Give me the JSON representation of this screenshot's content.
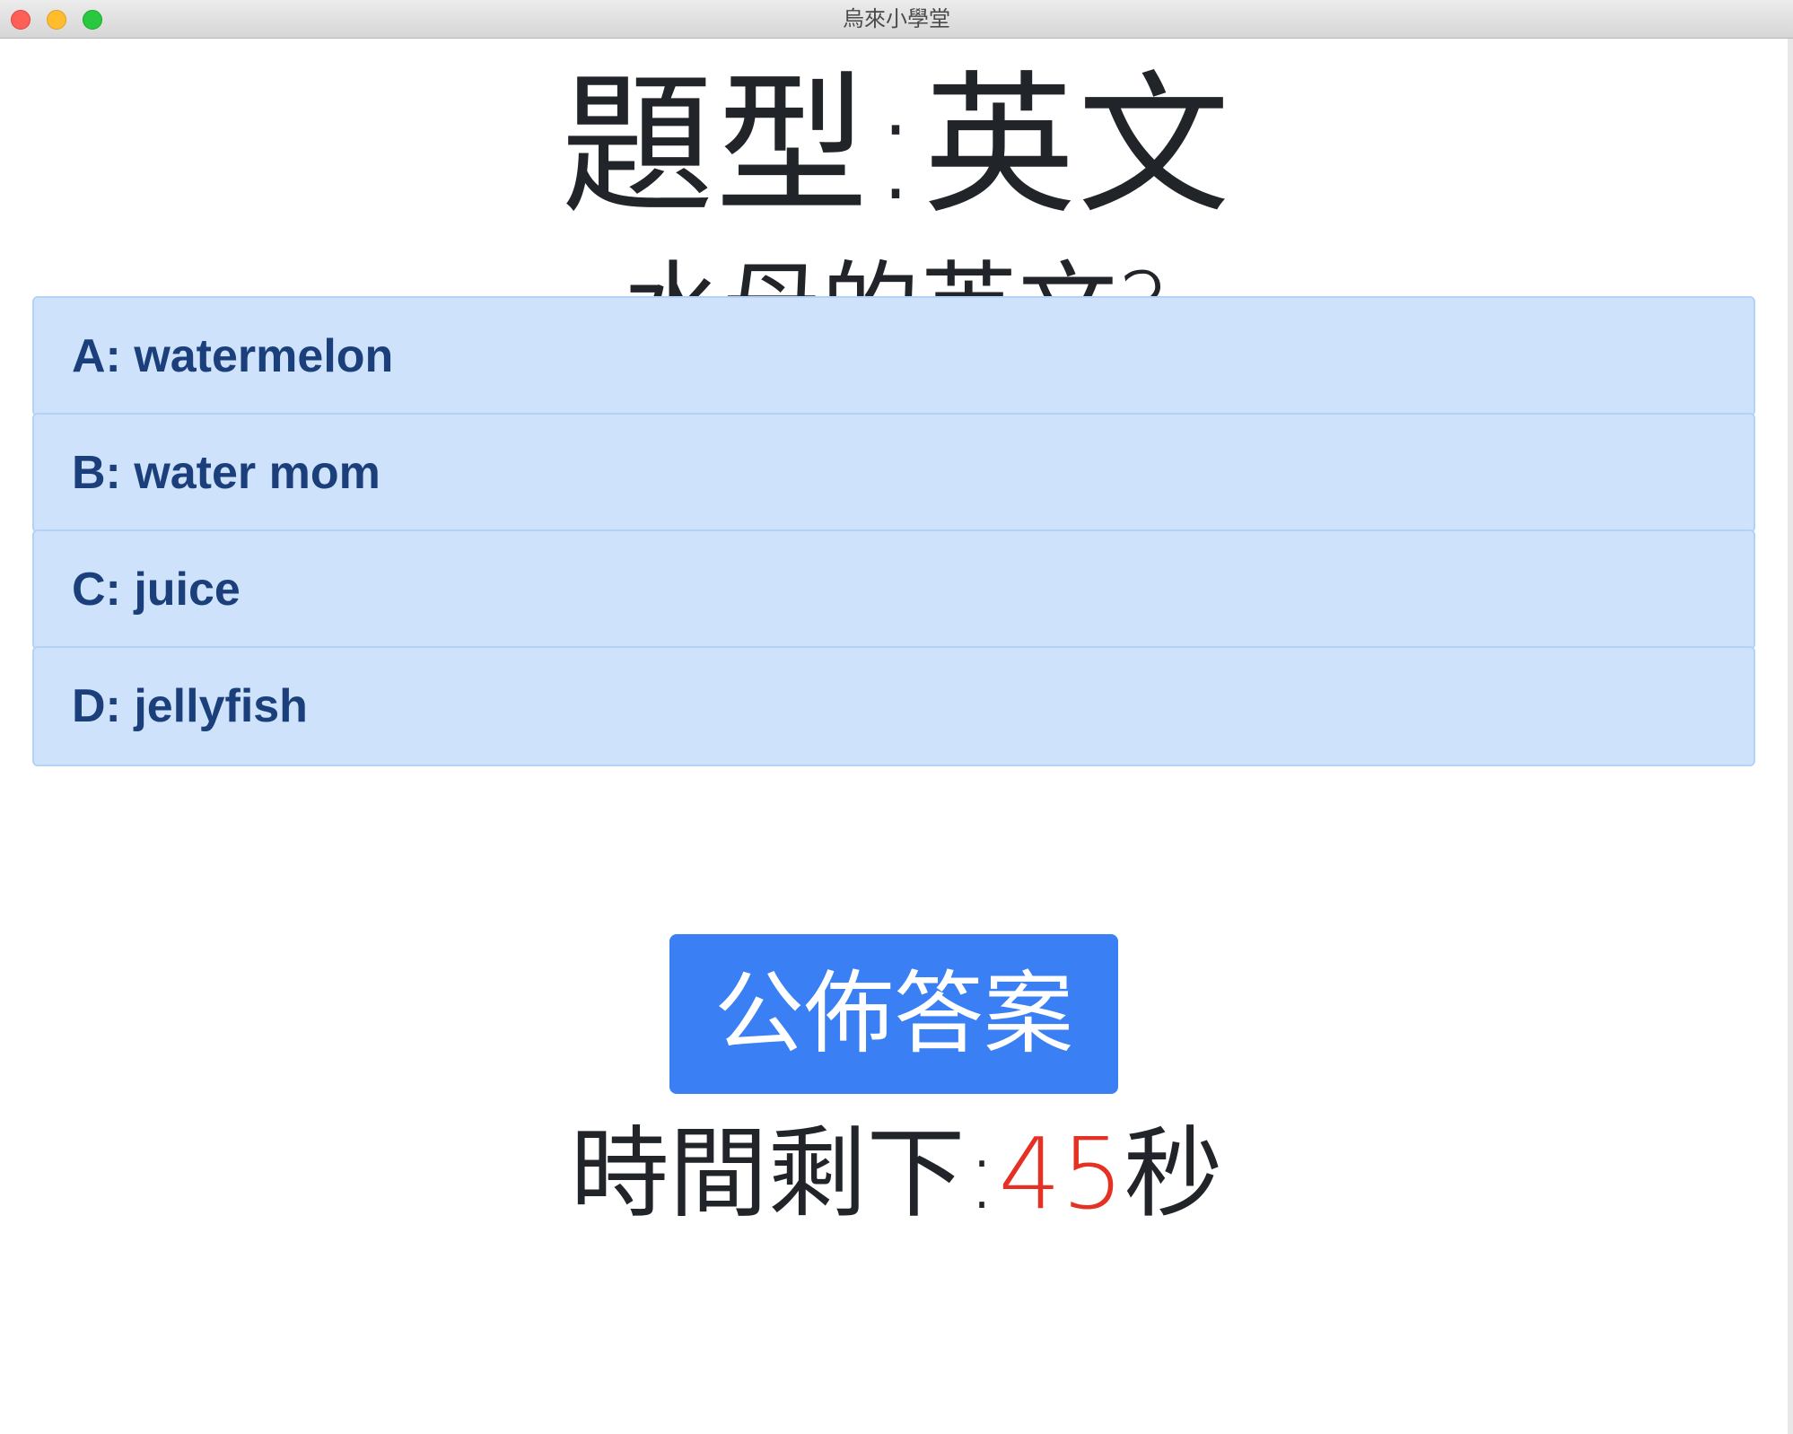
{
  "window": {
    "title": "烏來小學堂"
  },
  "quiz": {
    "category_label": "題型:英文",
    "question": "水母的英文?",
    "options": [
      {
        "text": "A: watermelon"
      },
      {
        "text": "B: water mom"
      },
      {
        "text": "C: juice"
      },
      {
        "text": "D: jellyfish"
      }
    ],
    "reveal_button_label": "公佈答案",
    "timer": {
      "prefix": "時間剩下:",
      "seconds": "45",
      "suffix": "秒"
    }
  },
  "colors": {
    "option_bg": "#cfe2fb",
    "option_text": "#1b3f7a",
    "button_bg": "#3a7ff3",
    "timer_seconds": "#e53124"
  }
}
